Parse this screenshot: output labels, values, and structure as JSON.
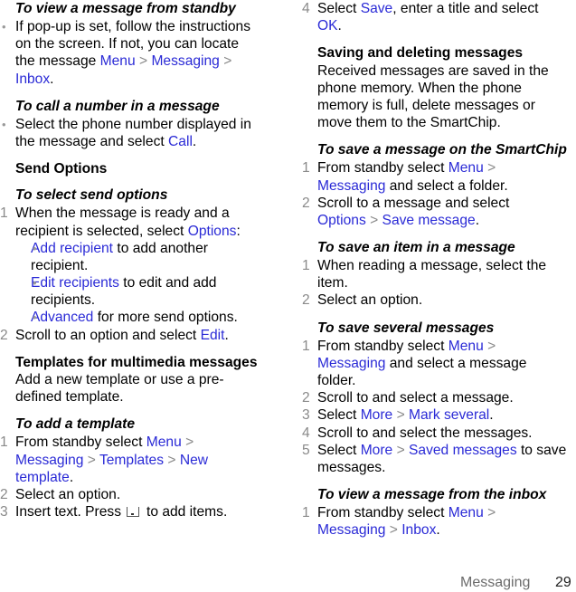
{
  "left": {
    "view_standby": {
      "heading": "To view a message from standby",
      "bullet_lines": [
        "If pop-up is set, follow the instructions",
        "on the screen. If not, you can locate",
        "the message "
      ],
      "path1": [
        "Menu",
        "Messaging"
      ],
      "path_end": "Inbox"
    },
    "call_number": {
      "heading": "To call a number in a message",
      "line1": "Select the phone number displayed in",
      "line2": "the message and select ",
      "link": "Call"
    },
    "send_options": {
      "title": "Send Options",
      "heading": "To select send options",
      "step1_line1": "When the message is ready and a",
      "step1_line2": "recipient is selected, select ",
      "step1_link": "Options",
      "sub_items": [
        {
          "link": "Add recipient",
          "text": " to add another",
          "cont": "recipient."
        },
        {
          "link": "Edit recipients",
          "text": " to edit and add",
          "cont": "recipients."
        },
        {
          "link": "Advanced",
          "text": " for more send options.",
          "cont": ""
        }
      ],
      "step2_text": "Scroll to an option and select ",
      "step2_link": "Edit"
    },
    "templates": {
      "title": "Templates for multimedia messages",
      "desc_line1": "Add a new template or use a pre-",
      "desc_line2": "defined template.",
      "heading": "To add a template",
      "step1_text": "From standby select ",
      "step1_links": [
        "Menu",
        "Messaging",
        "Templates",
        "New",
        "template"
      ],
      "step2": "Select an option.",
      "step3_a": "Insert text. Press",
      "step3_b": "to add items."
    }
  },
  "right": {
    "step4_text": "Select ",
    "step4_link": "Save",
    "step4_rest": ", enter a title and select",
    "step4_ok": "OK",
    "saving": {
      "title": "Saving and deleting messages",
      "desc": [
        "Received messages are saved in the",
        "phone memory. When the phone",
        "memory is full, delete messages or",
        "move them to the SmartChip."
      ]
    },
    "save_smartchip": {
      "heading": "To save a message on the SmartChip",
      "step1_text": "From standby select ",
      "step1_link1": "Menu",
      "step1_link2": "Messaging",
      "step1_rest": " and select a folder.",
      "step2_text": "Scroll to a message and select",
      "step2_link1": "Options",
      "step2_link2": "Save message"
    },
    "save_item": {
      "heading": "To save an item in a message",
      "step1_line1": "When reading a message, select the",
      "step1_line2": "item.",
      "step2": "Select an option."
    },
    "save_several": {
      "heading": "To save several messages",
      "step1_text": "From standby select ",
      "step1_link1": "Menu",
      "step1_link2": "Messaging",
      "step1_rest": " and select a message",
      "step1_cont": "folder.",
      "step2": "Scroll to and select a message.",
      "step3_text": "Select ",
      "step3_link1": "More",
      "step3_link2": "Mark several",
      "step4": "Scroll to and select the messages.",
      "step5_text": "Select ",
      "step5_link1": "More",
      "step5_link2": "Saved messages",
      "step5_rest": " to save",
      "step5_cont": "messages."
    },
    "view_inbox": {
      "heading": "To view a message from the inbox",
      "step1_text": "From standby select ",
      "step1_link1": "Menu",
      "step1_link2": "Messaging",
      "step1_link3": "Inbox"
    }
  },
  "separator": ">",
  "numbers": [
    "1",
    "2",
    "3",
    "4",
    "5"
  ],
  "bullet": "•",
  "footer": {
    "section": "Messaging",
    "page": "29"
  },
  "colors": {
    "link": "#2a2ad6",
    "step_number": "#8a8a8a",
    "footer_text": "#6b6b6b"
  }
}
